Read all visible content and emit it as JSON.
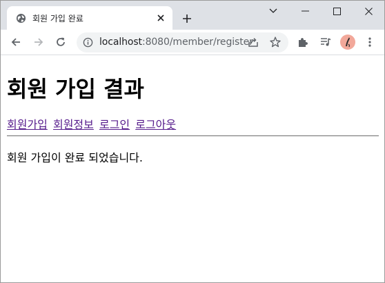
{
  "tab": {
    "title": "회원 가입 완료",
    "favicon": "globe-icon"
  },
  "toolbar": {
    "url_host": "localhost",
    "url_path": ":8080/member/register"
  },
  "page": {
    "title": "회원 가입 결과",
    "links": [
      "회원가입",
      "회원정보",
      "로그인",
      "로그아웃"
    ],
    "message": "회원 가입이 완료 되었습니다."
  },
  "colors": {
    "tabstrip": "#dee1e6",
    "omnibox": "#f1f3f4",
    "link_visited": "#551a8b",
    "avatar": "#f2a89a"
  }
}
